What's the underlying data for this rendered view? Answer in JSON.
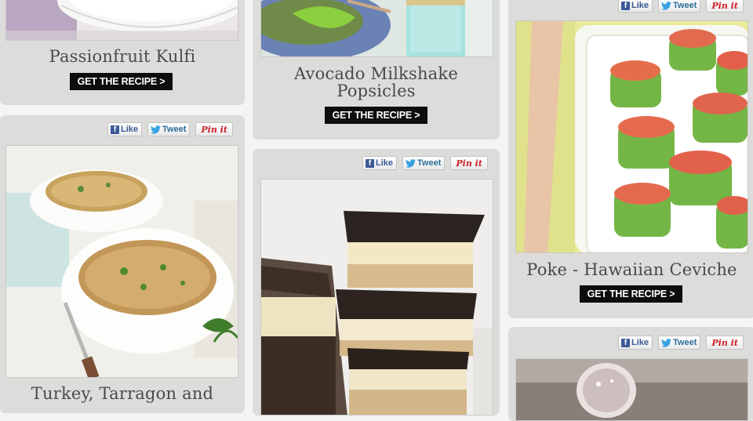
{
  "share": {
    "like": "Like",
    "tweet": "Tweet",
    "pin": "Pin it"
  },
  "cards": {
    "kulfi": {
      "title": "Passionfruit Kulfi",
      "cta": "GET THE RECIPE >"
    },
    "avocado": {
      "title_line1": "Avocado Milkshake",
      "title_line2": "Popsicles",
      "cta": "GET THE RECIPE >"
    },
    "poke": {
      "title": "Poke - Hawaiian Ceviche",
      "cta": "GET THE RECIPE >"
    },
    "turkey": {
      "title": "Turkey, Tarragon and"
    }
  },
  "colors": {
    "card": "#dcdcdb",
    "button": "#0d0d0d",
    "facebook": "#3b5998",
    "twitter": "#2b6e9b",
    "pinterest": "#cb2027"
  }
}
